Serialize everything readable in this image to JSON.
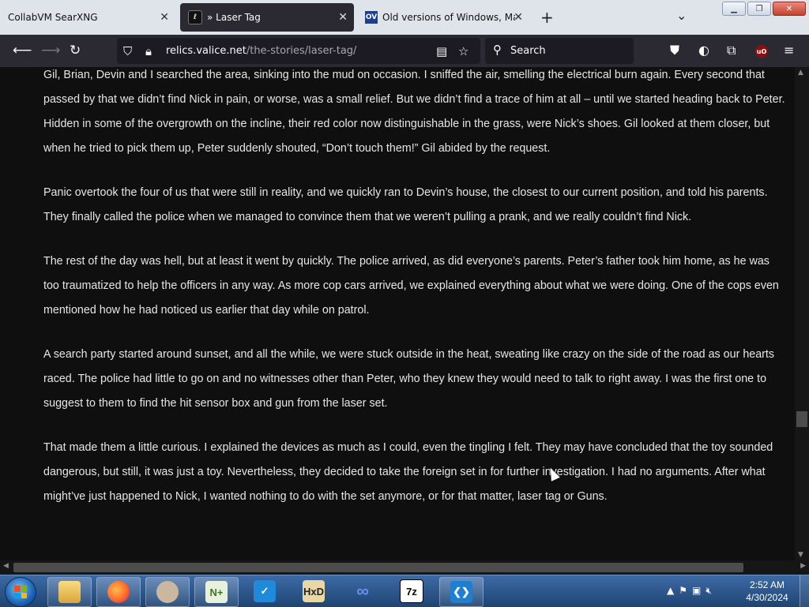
{
  "browser": {
    "tabs": [
      {
        "title": "CollabVM SearXNG",
        "active": false
      },
      {
        "title": "» Laser Tag",
        "active": true
      },
      {
        "title": "Old versions of Windows, Mac",
        "active": false,
        "favicon_text": "OV"
      }
    ],
    "url_host": "relics.valice.net",
    "url_path": "/the-stories/laser-tag/",
    "search_placeholder": "Search"
  },
  "article": {
    "paragraphs": [
      "Gil, Brian, Devin and I searched the area, sinking into the mud on occasion. I sniffed the air, smelling the electrical burn again. Every second that passed by that we didn’t find Nick in pain, or worse, was a small relief. But we didn’t find a trace of him at all – until we started heading back to Peter. Hidden in some of the overgrowth on the incline, their red color now distinguishable in the grass, were Nick’s shoes. Gil looked at them closer, but when he tried to pick them up, Peter suddenly shouted, “Don’t touch them!” Gil abided by the request.",
      "Panic overtook the four of us that were still in reality, and we quickly ran to Devin’s house, the closest to our current position, and told his parents. They finally called the police when we managed to convince them that we weren’t pulling a prank, and we really couldn’t find Nick.",
      "The rest of the day was hell, but at least it went by quickly. The police arrived, as did everyone’s parents. Peter’s father took him home, as he was too traumatized to help the officers in any way. As more cop cars arrived, we explained everything about what we were doing. One of the cops even mentioned how he had noticed us earlier that day while on patrol.",
      "A search party started around sunset, and all the while, we were stuck outside in the heat, sweating like crazy on the side of the road as our hearts raced. The police had little to go on and no witnesses other than Peter, who they knew they would need to talk to right away. I was the first one to suggest to them to find the hit sensor box and gun from the laser set.",
      "That made them a little curious. I explained the devices as much as I could, even the tingling I felt. They may have concluded that the toy sounded dangerous, but still, it was just a toy. Nevertheless, they decided to take the foreign set in for further investigation. I had no arguments. After what might’ve just happened to Nick, I wanted nothing to do with the set anymore, or for that matter, laser tag or Guns."
    ]
  },
  "taskbar": {
    "time": "2:52 AM",
    "date": "4/30/2024",
    "apps": [
      "file-explorer",
      "firefox",
      "user-avatar",
      "notepad-plus-plus",
      "task-app",
      "hxd-hex-editor",
      "infinity-app",
      "7-zip",
      "visual-studio-code"
    ]
  },
  "colors": {
    "page_bg": "#0f0f0f",
    "text": "#e6e6e6",
    "toolbar": "#2b2a33",
    "taskbar": "#2a5a94"
  }
}
